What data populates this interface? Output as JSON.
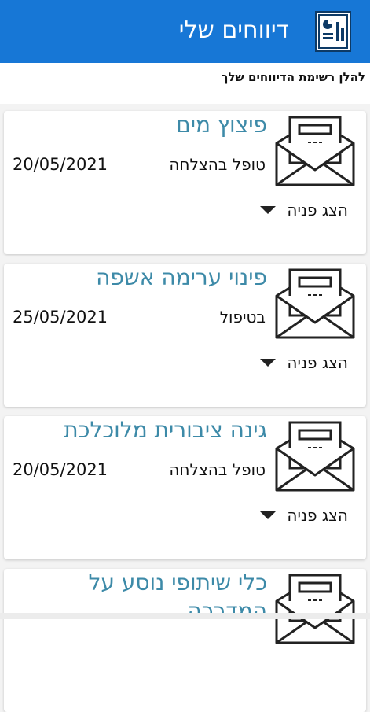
{
  "header": {
    "title": "דיווחים שלי",
    "icon": "report-document-icon",
    "background_color": "#1777d6"
  },
  "subheader": {
    "text": "להלן רשימת הדיווחים שלך"
  },
  "reports": [
    {
      "title": "פיצוץ מים",
      "status": "טופל בהצלחה",
      "date": "20/05/2021",
      "toggle_label": "הצג פניה",
      "icon": "envelope-letter-icon"
    },
    {
      "title": "פינוי ערימה אשפה",
      "status": "בטיפול",
      "date": "25/05/2021",
      "toggle_label": "הצג פניה",
      "icon": "envelope-letter-icon"
    },
    {
      "title": "גינה ציבורית מלוכלכת",
      "status": "טופל בהצלחה",
      "date": "20/05/2021",
      "toggle_label": "הצג פניה",
      "icon": "envelope-letter-icon"
    },
    {
      "title": "כלי שיתופי נוסע על המדרכה",
      "status": "",
      "date": "",
      "toggle_label": "",
      "icon": "envelope-letter-icon"
    }
  ],
  "colors": {
    "title_text": "#3d8aa8",
    "page_background": "#f3f3f3"
  }
}
